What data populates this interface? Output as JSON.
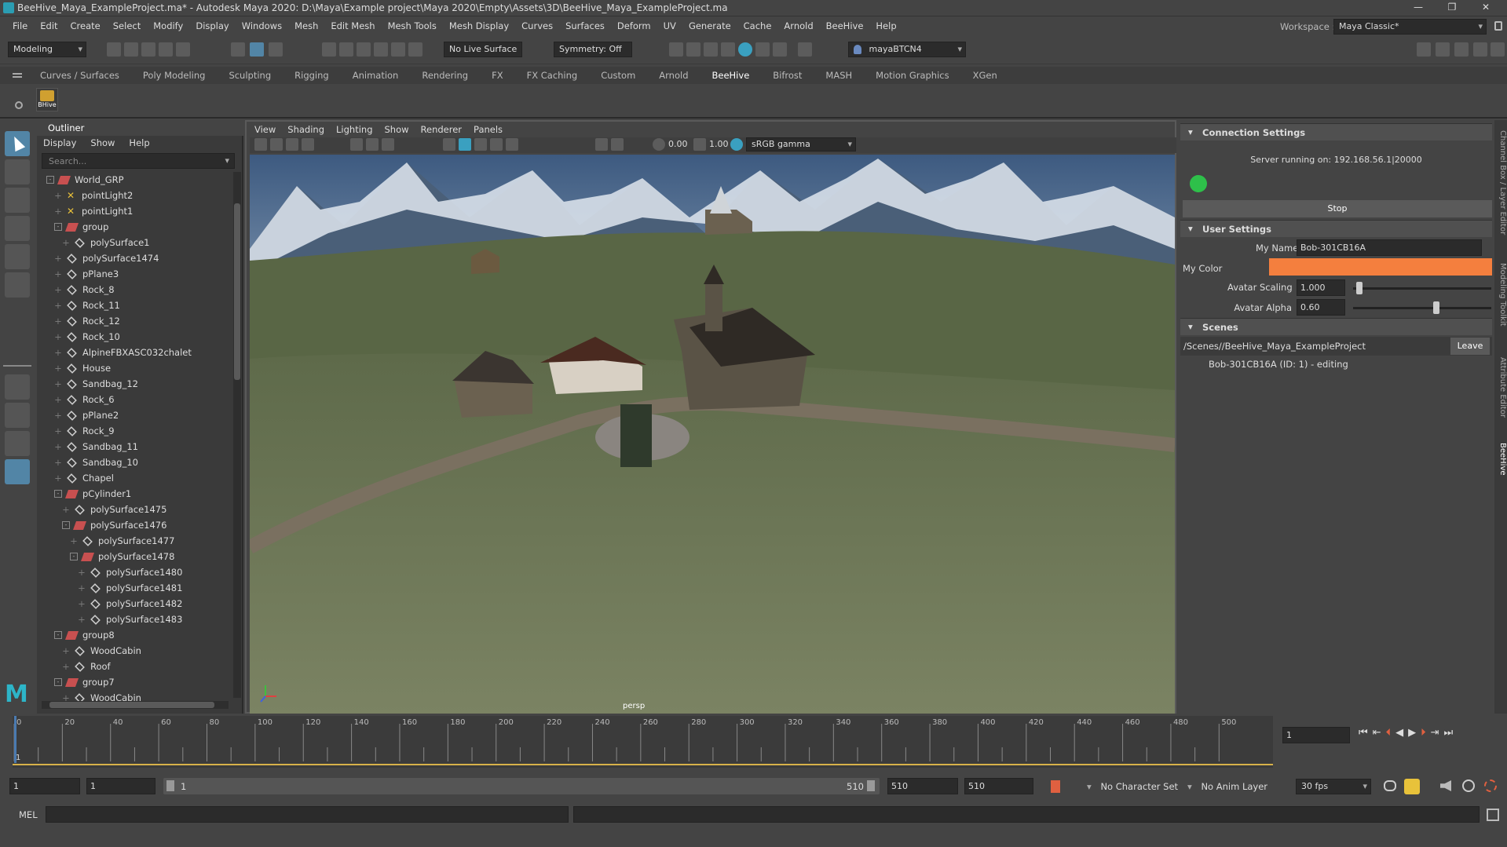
{
  "window": {
    "title": "BeeHive_Maya_ExampleProject.ma* - Autodesk Maya 2020: D:\\Maya\\Example project\\Maya 2020\\Empty\\Assets\\3D\\BeeHive_Maya_ExampleProject.ma",
    "minimize": "—",
    "maximize": "❐",
    "close": "✕"
  },
  "menus": [
    "File",
    "Edit",
    "Create",
    "Select",
    "Modify",
    "Display",
    "Windows",
    "Mesh",
    "Edit Mesh",
    "Mesh Tools",
    "Mesh Display",
    "Curves",
    "Surfaces",
    "Deform",
    "UV",
    "Generate",
    "Cache",
    "Arnold",
    "BeeHive",
    "Help"
  ],
  "workspace": {
    "label": "Workspace :",
    "value": "Maya Classic*"
  },
  "statusline": {
    "mode": "Modeling",
    "live_surface": "No Live Surface",
    "symmetry": "Symmetry: Off",
    "user": "mayaBTCN4"
  },
  "shelf_tabs": [
    "Curves / Surfaces",
    "Poly Modeling",
    "Sculpting",
    "Rigging",
    "Animation",
    "Rendering",
    "FX",
    "FX Caching",
    "Custom",
    "Arnold",
    "BeeHive",
    "Bifrost",
    "MASH",
    "Motion Graphics",
    "XGen"
  ],
  "shelf_active": "BeeHive",
  "shelf_button": "BHive",
  "outliner": {
    "title": "Outliner",
    "menus": [
      "Display",
      "Show",
      "Help"
    ],
    "search_placeholder": "Search...",
    "items": [
      {
        "label": "World_GRP",
        "depth": 0,
        "icon": "group",
        "exp": "-"
      },
      {
        "label": "pointLight2",
        "depth": 1,
        "icon": "light",
        "exp": ""
      },
      {
        "label": "pointLight1",
        "depth": 1,
        "icon": "light",
        "exp": ""
      },
      {
        "label": "group",
        "depth": 1,
        "icon": "group",
        "exp": "-"
      },
      {
        "label": "polySurface1",
        "depth": 2,
        "icon": "mesh",
        "exp": ""
      },
      {
        "label": "polySurface1474",
        "depth": 1,
        "icon": "mesh",
        "exp": ""
      },
      {
        "label": "pPlane3",
        "depth": 1,
        "icon": "mesh",
        "exp": ""
      },
      {
        "label": "Rock_8",
        "depth": 1,
        "icon": "mesh",
        "exp": ""
      },
      {
        "label": "Rock_11",
        "depth": 1,
        "icon": "mesh",
        "exp": ""
      },
      {
        "label": "Rock_12",
        "depth": 1,
        "icon": "mesh",
        "exp": ""
      },
      {
        "label": "Rock_10",
        "depth": 1,
        "icon": "mesh",
        "exp": ""
      },
      {
        "label": "AlpineFBXASC032chalet",
        "depth": 1,
        "icon": "mesh",
        "exp": ""
      },
      {
        "label": "House",
        "depth": 1,
        "icon": "mesh",
        "exp": ""
      },
      {
        "label": "Sandbag_12",
        "depth": 1,
        "icon": "mesh",
        "exp": ""
      },
      {
        "label": "Rock_6",
        "depth": 1,
        "icon": "mesh",
        "exp": ""
      },
      {
        "label": "pPlane2",
        "depth": 1,
        "icon": "mesh",
        "exp": ""
      },
      {
        "label": "Rock_9",
        "depth": 1,
        "icon": "mesh",
        "exp": ""
      },
      {
        "label": "Sandbag_11",
        "depth": 1,
        "icon": "mesh",
        "exp": ""
      },
      {
        "label": "Sandbag_10",
        "depth": 1,
        "icon": "mesh",
        "exp": ""
      },
      {
        "label": "Chapel",
        "depth": 1,
        "icon": "mesh",
        "exp": ""
      },
      {
        "label": "pCylinder1",
        "depth": 1,
        "icon": "group",
        "exp": "-"
      },
      {
        "label": "polySurface1475",
        "depth": 2,
        "icon": "mesh",
        "exp": ""
      },
      {
        "label": "polySurface1476",
        "depth": 2,
        "icon": "group",
        "exp": "-"
      },
      {
        "label": "polySurface1477",
        "depth": 3,
        "icon": "mesh",
        "exp": ""
      },
      {
        "label": "polySurface1478",
        "depth": 3,
        "icon": "group",
        "exp": "-"
      },
      {
        "label": "polySurface1480",
        "depth": 4,
        "icon": "mesh",
        "exp": ""
      },
      {
        "label": "polySurface1481",
        "depth": 4,
        "icon": "mesh",
        "exp": ""
      },
      {
        "label": "polySurface1482",
        "depth": 4,
        "icon": "mesh",
        "exp": ""
      },
      {
        "label": "polySurface1483",
        "depth": 4,
        "icon": "mesh",
        "exp": ""
      },
      {
        "label": "group8",
        "depth": 1,
        "icon": "group",
        "exp": "-"
      },
      {
        "label": "WoodCabin",
        "depth": 2,
        "icon": "mesh",
        "exp": ""
      },
      {
        "label": "Roof",
        "depth": 2,
        "icon": "mesh",
        "exp": ""
      },
      {
        "label": "group7",
        "depth": 1,
        "icon": "group",
        "exp": "-"
      },
      {
        "label": "WoodCabin",
        "depth": 2,
        "icon": "mesh",
        "exp": ""
      }
    ]
  },
  "viewport": {
    "menus": [
      "View",
      "Shading",
      "Lighting",
      "Show",
      "Renderer",
      "Panels"
    ],
    "exposure": "0.00",
    "gamma": "1.00",
    "colorspace": "sRGB gamma",
    "camera_label": "persp"
  },
  "beehive": {
    "connection_header": "Connection Settings",
    "server_status": "Server running on: 192.168.56.1|20000",
    "stop_label": "Stop",
    "user_header": "User Settings",
    "name_label": "My Name",
    "name_value": "Bob-301CB16A",
    "color_label": "My Color",
    "color_value": "#f47f3e",
    "avatar_scaling_label": "Avatar Scaling",
    "avatar_scaling_value": "1.000",
    "avatar_alpha_label": "Avatar Alpha",
    "avatar_alpha_value": "0.60",
    "scenes_header": "Scenes",
    "scene_path": "/Scenes//BeeHive_Maya_ExampleProject",
    "leave_label": "Leave",
    "scene_user": "Bob-301CB16A (ID: 1)  -  editing"
  },
  "side_tabs": [
    "Channel Box / Layer Editor",
    "Modeling Toolkit",
    "Attribute Editor",
    "BeeHive"
  ],
  "timeline": {
    "ticks": [
      "0",
      "20",
      "40",
      "60",
      "80",
      "100",
      "120",
      "140",
      "160",
      "180",
      "200",
      "220",
      "240",
      "260",
      "280",
      "300",
      "320",
      "340",
      "360",
      "380",
      "400",
      "420",
      "440",
      "460",
      "480",
      "500"
    ],
    "current_frame": "1",
    "frame_field": "1"
  },
  "range": {
    "start": "1",
    "anim_start": "1",
    "slider_start": "1",
    "slider_end": "510",
    "anim_end": "510",
    "end": "510",
    "character_set": "No Character Set",
    "anim_layer": "No Anim Layer",
    "fps": "30 fps"
  },
  "command": {
    "lang": "MEL"
  }
}
